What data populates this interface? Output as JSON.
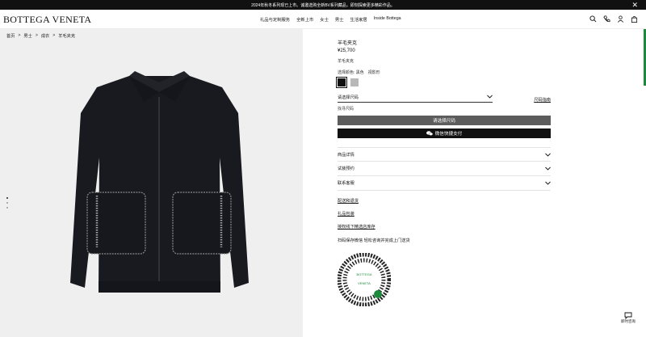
{
  "topbar": {
    "announcement": "2024年秋冬系列现已上市。诚邀选购全新BV系列藏品，即刻探索更多精彩作品。",
    "close_label": "✕"
  },
  "header": {
    "logo": "BOTTEGA VENETA",
    "nav": [
      "礼品与定制服务",
      "全新上市",
      "女士",
      "男士",
      "生活家居",
      "Inside Bottega"
    ]
  },
  "breadcrumb": [
    "首页",
    "男士",
    "成衣",
    "羊毛夹克"
  ],
  "separator": ">",
  "product": {
    "title": "羊毛夹克",
    "price": "¥25,700",
    "subtitle": "羊毛夹克",
    "color_label": "选择颜色: 黑色　视影形",
    "size_placeholder": "请选择尺码",
    "size_guide": "尺码指南",
    "size_note": "找寻尺码",
    "select_size_button": "请选择尺码",
    "wechat_pay_button": "微信快捷支付"
  },
  "accordion": [
    "商品详情",
    "试装预约",
    "联系客服"
  ],
  "links": [
    "配送和退货",
    "礼品包装",
    "授权线下精选店库存"
  ],
  "qr_note": "扫码保存微信 轻松咨询并完成上门送货",
  "qr_text": [
    "BOTTEGA",
    "VENETA"
  ],
  "chat_label": "即时咨询",
  "colors": {
    "accent": "#1c8a3b",
    "primary": "#111111",
    "disabled": "#5c5c5c"
  }
}
